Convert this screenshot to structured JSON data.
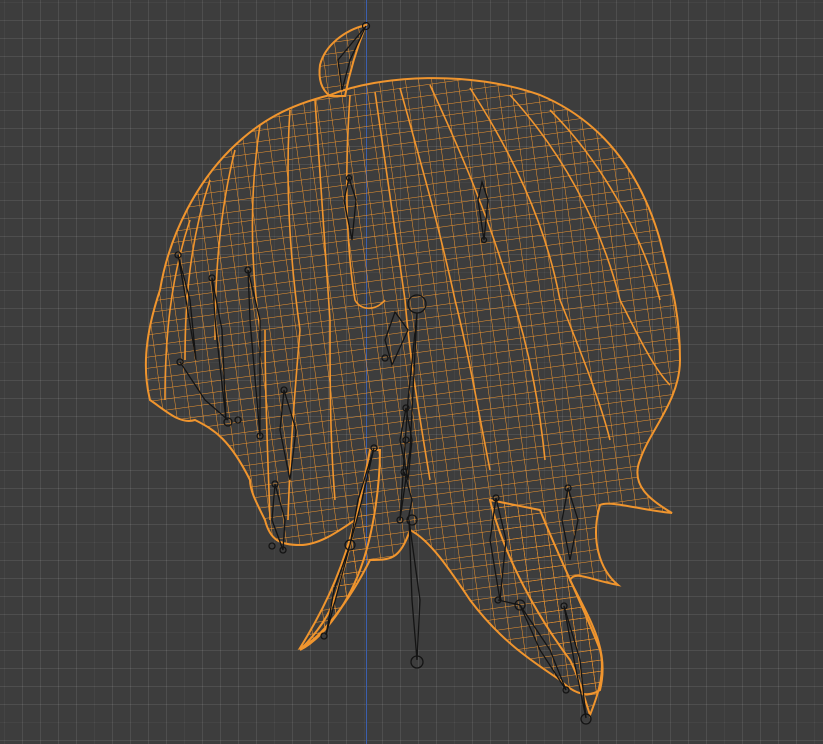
{
  "viewport": {
    "name": "3d-viewport",
    "background": "#3d3d3d",
    "axis_color": "#3b5fae"
  },
  "mesh": {
    "name": "hair-mesh",
    "wire_color": "#f0952e",
    "selected": true
  },
  "armature": {
    "name": "hair-bones",
    "color": "#141414"
  }
}
